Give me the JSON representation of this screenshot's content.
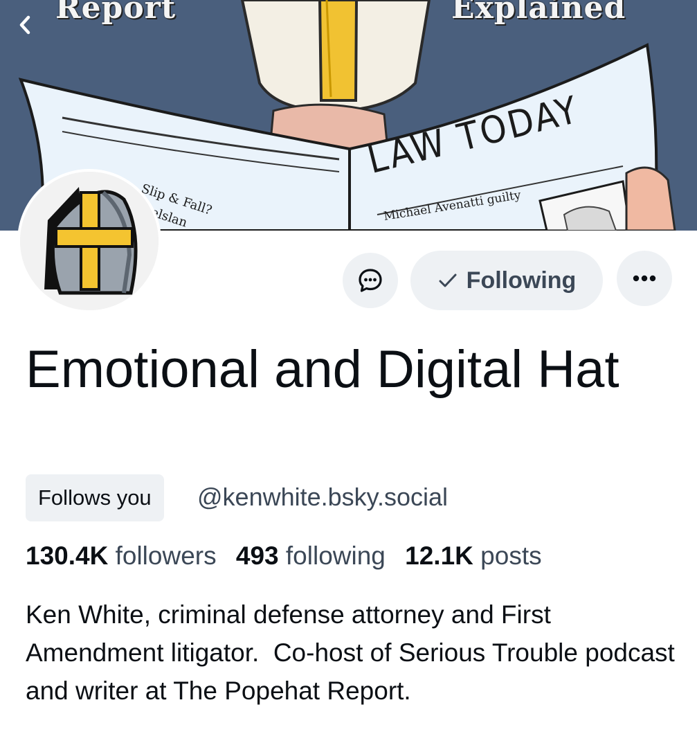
{
  "banner": {
    "word_left": "Report",
    "word_right": "Explained",
    "masthead": "LAW TODAY",
    "headline": "Michael Avenatti guilty",
    "side_headline": "Slip & Fall?",
    "side_fragment": "elslan"
  },
  "actions": {
    "message_icon": "chat-bubble-icon",
    "follow_check": "✓",
    "follow_label": "Following",
    "more_icon": "ellipsis-icon"
  },
  "profile": {
    "display_name": "Emotional and Digital Hat",
    "follows_you": "Follows you",
    "handle": "@kenwhite.bsky.social",
    "followers_count": "130.4K",
    "followers_label": "followers",
    "following_count": "493",
    "following_label": "following",
    "posts_count": "12.1K",
    "posts_label": "posts",
    "bio": "Ken White, criminal defense attorney and First Amendment litigator.  Co-host of Serious Trouble podcast and writer at The Popehat Report."
  },
  "colors": {
    "banner_bg": "#4a5f7d",
    "pill_bg": "#eef1f4",
    "secondary_text": "#3b4756",
    "primary_text": "#0b0f14"
  }
}
